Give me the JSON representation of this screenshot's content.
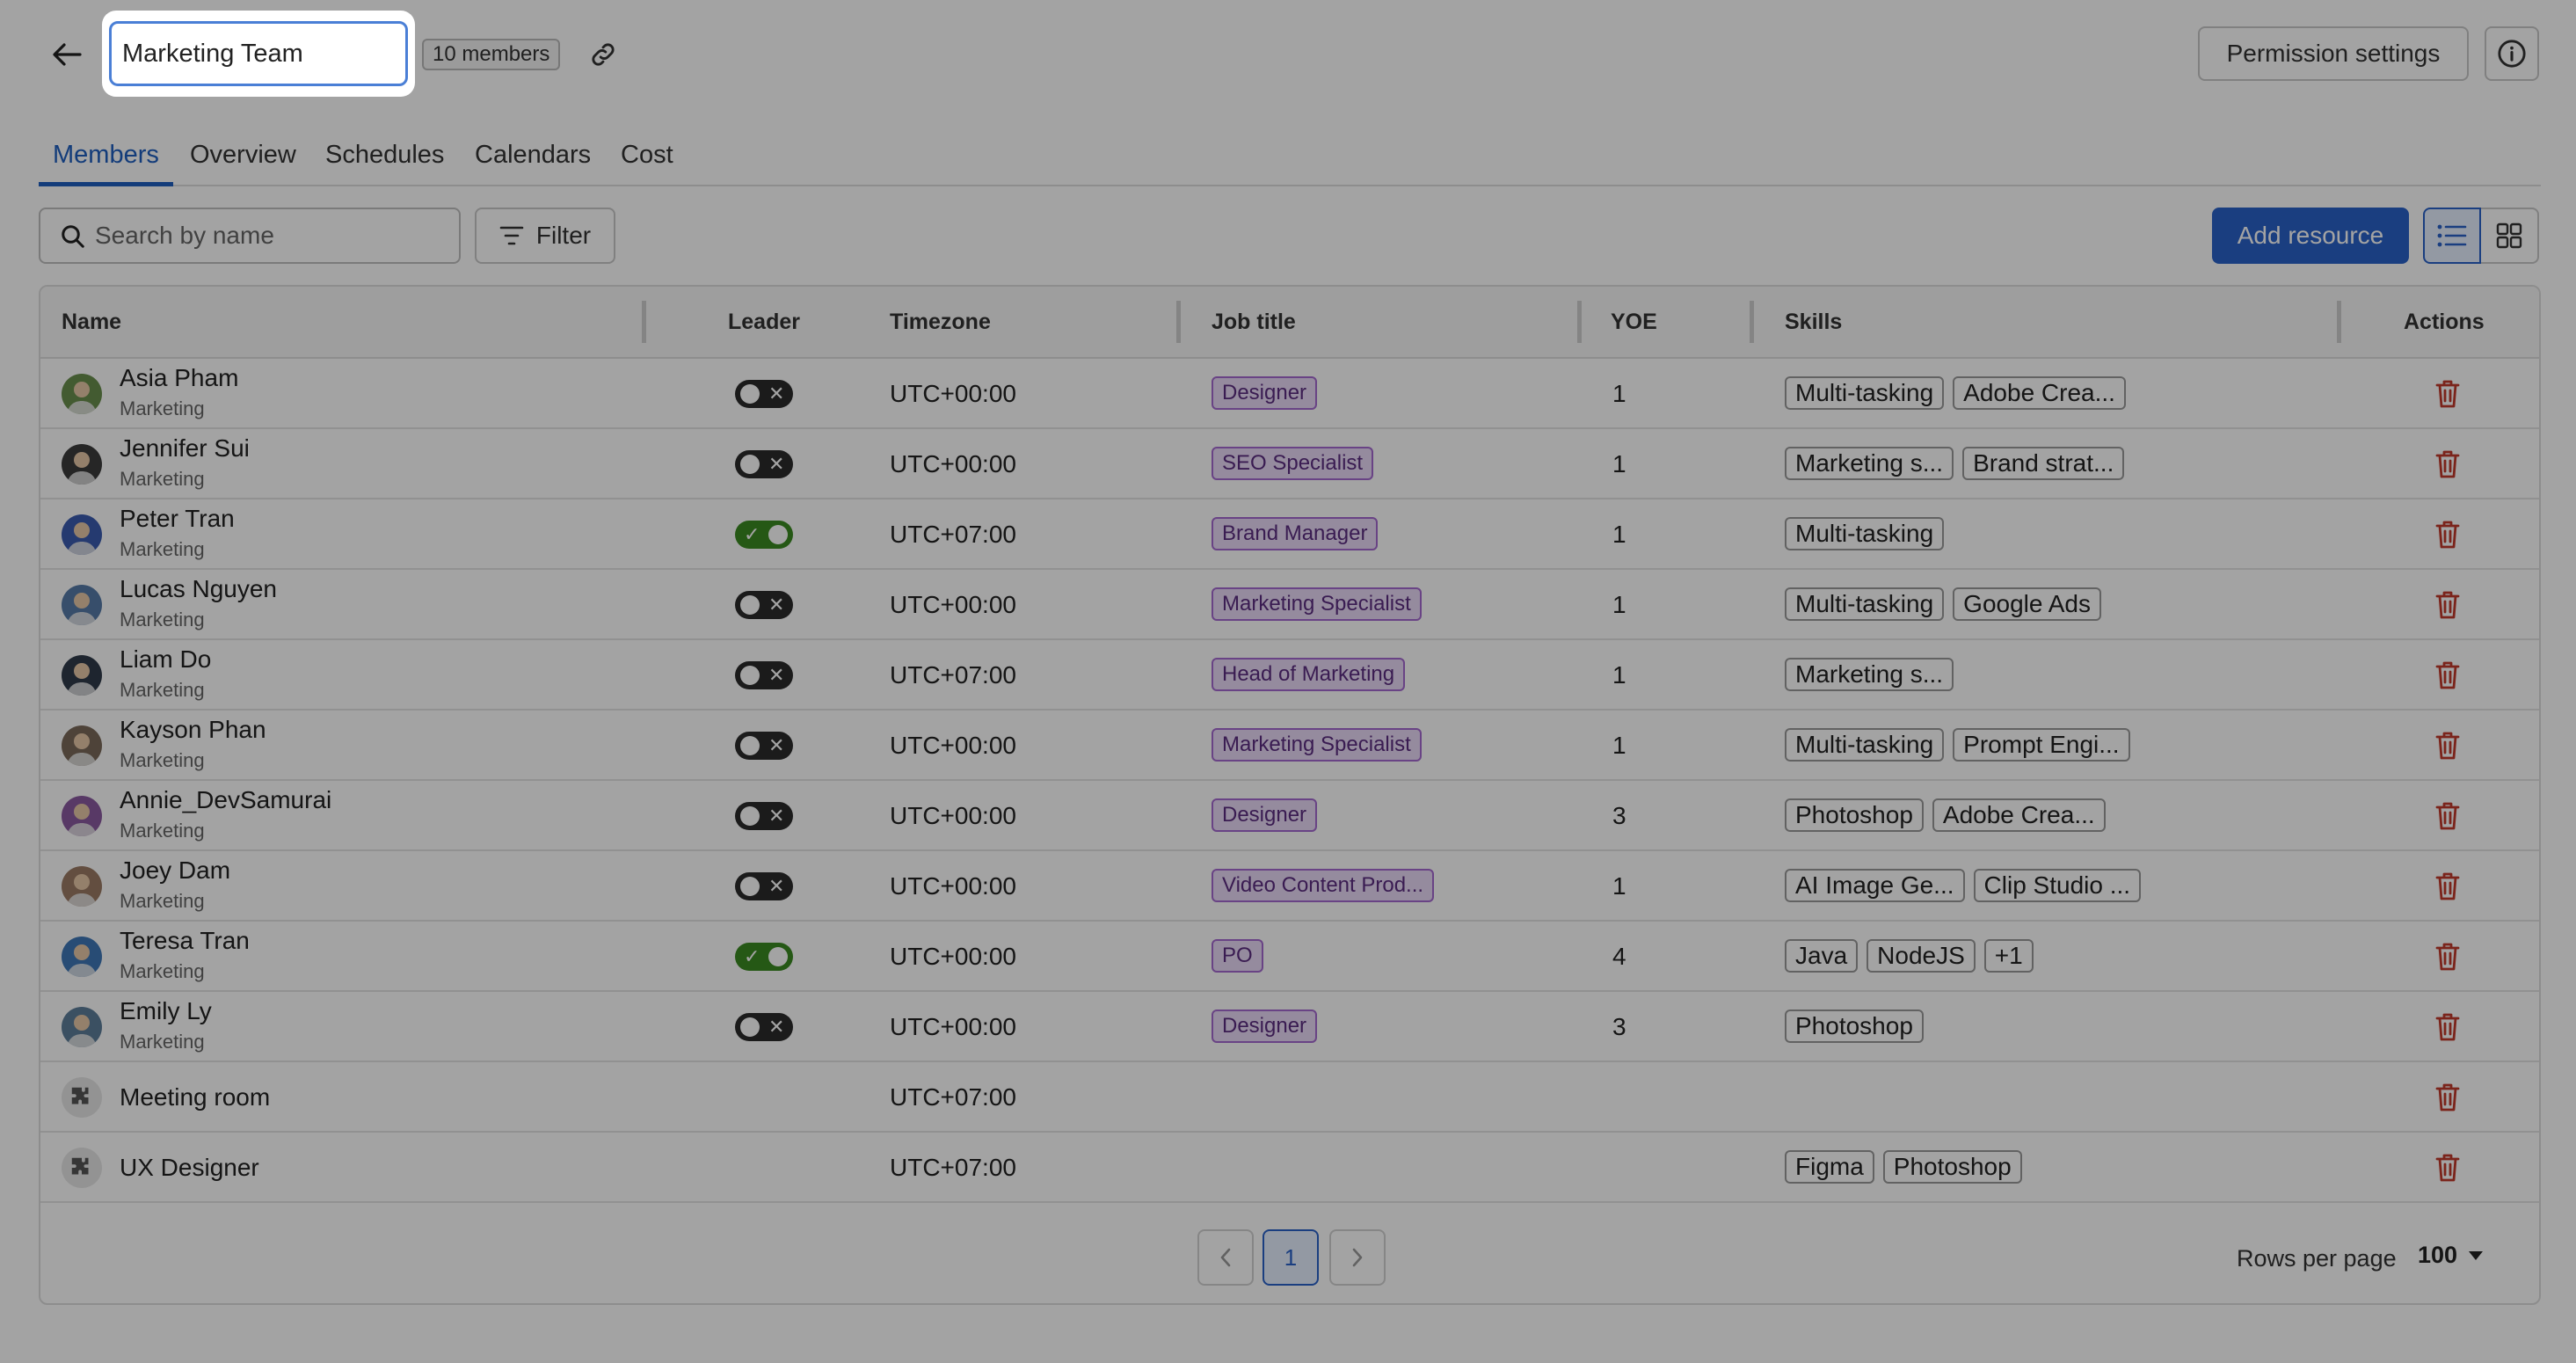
{
  "header": {
    "team_name": "Marketing Team",
    "members_badge": "10 members",
    "permission_label": "Permission settings"
  },
  "tabs": [
    {
      "label": "Members",
      "active": true
    },
    {
      "label": "Overview",
      "active": false
    },
    {
      "label": "Schedules",
      "active": false
    },
    {
      "label": "Calendars",
      "active": false
    },
    {
      "label": "Cost",
      "active": false
    }
  ],
  "toolbar": {
    "search_placeholder": "Search by name",
    "filter_label": "Filter",
    "add_label": "Add resource"
  },
  "table": {
    "headers": {
      "name": "Name",
      "leader": "Leader",
      "timezone": "Timezone",
      "job_title": "Job title",
      "yoe": "YOE",
      "skills": "Skills",
      "actions": "Actions"
    },
    "rows": [
      {
        "name": "Asia Pham",
        "team": "Marketing",
        "leader": false,
        "timezone": "UTC+00:00",
        "job": "Designer",
        "yoe": "1",
        "skills": [
          "Multi-tasking",
          "Adobe Crea..."
        ]
      },
      {
        "name": "Jennifer Sui",
        "team": "Marketing",
        "leader": false,
        "timezone": "UTC+00:00",
        "job": "SEO Specialist",
        "yoe": "1",
        "skills": [
          "Marketing s...",
          "Brand strat..."
        ]
      },
      {
        "name": "Peter Tran",
        "team": "Marketing",
        "leader": true,
        "timezone": "UTC+07:00",
        "job": "Brand Manager",
        "yoe": "1",
        "skills": [
          "Multi-tasking"
        ]
      },
      {
        "name": "Lucas Nguyen",
        "team": "Marketing",
        "leader": false,
        "timezone": "UTC+00:00",
        "job": "Marketing Specialist",
        "yoe": "1",
        "skills": [
          "Multi-tasking",
          "Google Ads"
        ]
      },
      {
        "name": "Liam Do",
        "team": "Marketing",
        "leader": false,
        "timezone": "UTC+07:00",
        "job": "Head of Marketing",
        "yoe": "1",
        "skills": [
          "Marketing s..."
        ]
      },
      {
        "name": "Kayson Phan",
        "team": "Marketing",
        "leader": false,
        "timezone": "UTC+00:00",
        "job": "Marketing Specialist",
        "yoe": "1",
        "skills": [
          "Multi-tasking",
          "Prompt Engi..."
        ]
      },
      {
        "name": "Annie_DevSamurai",
        "team": "Marketing",
        "leader": false,
        "timezone": "UTC+00:00",
        "job": "Designer",
        "yoe": "3",
        "skills": [
          "Photoshop",
          "Adobe Crea..."
        ]
      },
      {
        "name": "Joey Dam",
        "team": "Marketing",
        "leader": false,
        "timezone": "UTC+00:00",
        "job": "Video Content Prod...",
        "yoe": "1",
        "skills": [
          "AI Image Ge...",
          "Clip Studio ..."
        ]
      },
      {
        "name": "Teresa Tran",
        "team": "Marketing",
        "leader": true,
        "timezone": "UTC+00:00",
        "job": "PO",
        "yoe": "4",
        "skills": [
          "Java",
          "NodeJS",
          "+1"
        ]
      },
      {
        "name": "Emily Ly",
        "team": "Marketing",
        "leader": false,
        "timezone": "UTC+00:00",
        "job": "Designer",
        "yoe": "3",
        "skills": [
          "Photoshop"
        ]
      },
      {
        "name": "Meeting room",
        "team": "",
        "leader": null,
        "timezone": "UTC+07:00",
        "job": "",
        "yoe": "",
        "skills": []
      },
      {
        "name": "UX Designer",
        "team": "",
        "leader": null,
        "timezone": "UTC+07:00",
        "job": "",
        "yoe": "",
        "skills": [
          "Figma",
          "Photoshop"
        ]
      }
    ]
  },
  "pagination": {
    "current_page": "1",
    "rows_per_page_label": "Rows per page",
    "rows_per_page_value": "100"
  },
  "colors": {
    "accent": "#2a62c9",
    "leader_on": "#3b8a22",
    "delete": "#c0392b",
    "job_tag": "#ead9f7"
  }
}
